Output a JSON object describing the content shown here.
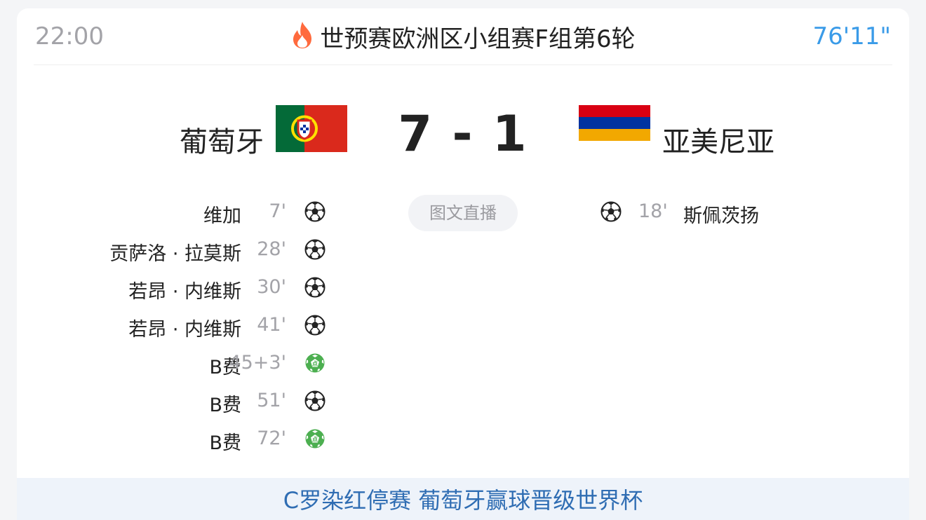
{
  "header": {
    "kickoff_time": "22:00",
    "competition": "世预赛欧洲区小组赛F组第6轮",
    "match_minute": "76'11\"",
    "hot_icon": "flame-icon"
  },
  "match": {
    "home": {
      "name": "葡萄牙",
      "flag": "portugal-flag"
    },
    "away": {
      "name": "亚美尼亚",
      "flag": "armenia-flag"
    },
    "score": "7 - 1"
  },
  "live_button": {
    "label": "图文直播"
  },
  "home_goals": [
    {
      "player": "维加",
      "time": "7'",
      "type": "goal"
    },
    {
      "player": "贡萨洛 · 拉莫斯",
      "time": "28'",
      "type": "goal"
    },
    {
      "player": "若昂 · 内维斯",
      "time": "30'",
      "type": "goal"
    },
    {
      "player": "若昂 · 内维斯",
      "time": "41'",
      "type": "goal"
    },
    {
      "player": "B费",
      "time": "45+3'",
      "type": "penalty"
    },
    {
      "player": "B费",
      "time": "51'",
      "type": "goal"
    },
    {
      "player": "B费",
      "time": "72'",
      "type": "penalty"
    }
  ],
  "away_goals": [
    {
      "player": "斯佩茨扬",
      "time": "18'",
      "type": "goal"
    }
  ],
  "headline": "C罗染红停赛 葡萄牙赢球晋级世界杯",
  "colors": {
    "accent_blue": "#3a9be8",
    "penalty_green": "#4caf50",
    "portugal_green": "#046a38",
    "portugal_red": "#da291c",
    "armenia_red": "#d90012",
    "armenia_blue": "#0033a0",
    "armenia_orange": "#f2a800"
  }
}
